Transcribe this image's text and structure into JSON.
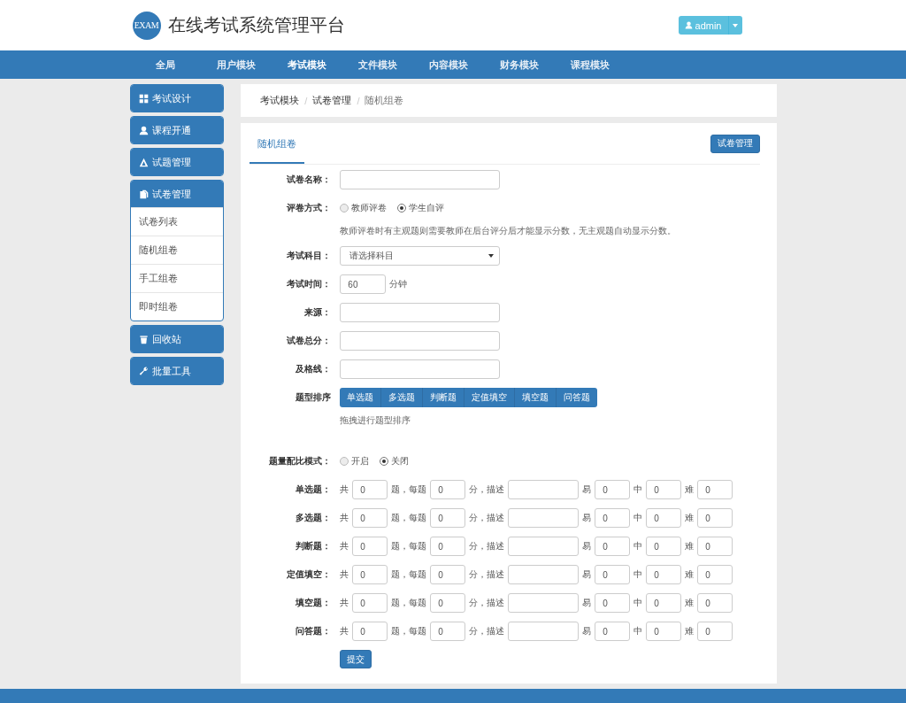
{
  "header": {
    "logo": "EXAM",
    "title": "在线考试系统管理平台",
    "user": "admin"
  },
  "nav": [
    {
      "label": "全局",
      "selected": false
    },
    {
      "label": "用户模块",
      "selected": false
    },
    {
      "label": "考试模块",
      "selected": true
    },
    {
      "label": "文件模块",
      "selected": false
    },
    {
      "label": "内容模块",
      "selected": false
    },
    {
      "label": "财务模块",
      "selected": false
    },
    {
      "label": "课程模块",
      "selected": false
    }
  ],
  "sidebar": [
    {
      "label": "考试设计"
    },
    {
      "label": "课程开通"
    },
    {
      "label": "试题管理"
    },
    {
      "label": "试卷管理",
      "children": [
        {
          "label": "试卷列表",
          "selected": false
        },
        {
          "label": "随机组卷",
          "selected": false
        },
        {
          "label": "手工组卷",
          "selected": false
        },
        {
          "label": "即时组卷",
          "selected": false
        }
      ]
    },
    {
      "label": "回收站"
    },
    {
      "label": "批量工具"
    }
  ],
  "breadcrumb": [
    {
      "label": "考试模块",
      "separator": "/"
    },
    {
      "label": "试卷管理",
      "separator": "/"
    },
    {
      "label": "随机组卷"
    }
  ],
  "tab": "随机组卷",
  "manage_button": "试卷管理",
  "fields": [
    {
      "kind": "text",
      "label": "试卷名称："
    },
    {
      "kind": "radio",
      "label": "评卷方式：",
      "options": [
        {
          "label": "教师评卷",
          "selected": false
        },
        {
          "label": "学生自评",
          "selected": true
        }
      ],
      "hint": "教师评卷时有主观题则需要教师在后台评分后才能显示分数，无主观题自动显示分数。"
    },
    {
      "kind": "select",
      "label": "考试科目：",
      "value": "请选择科目"
    },
    {
      "kind": "unit",
      "label": "考试时间：",
      "value": "60",
      "unit": "分钟"
    },
    {
      "kind": "text",
      "label": "来源："
    },
    {
      "kind": "text",
      "label": "试卷总分："
    },
    {
      "kind": "text",
      "label": "及格线："
    },
    {
      "kind": "sort",
      "label": "题型排序",
      "items": [
        "单选题",
        "多选题",
        "判断题",
        "定值填空",
        "填空题",
        "问答题"
      ],
      "hint": "拖拽进行题型排序"
    },
    {
      "kind": "radio",
      "label": "题量配比模式：",
      "options": [
        {
          "label": "开启",
          "selected": false
        },
        {
          "label": "关闭",
          "selected": true
        }
      ]
    }
  ],
  "question_rows": [
    {
      "label": "单选题：",
      "total_label": "共",
      "count": "0",
      "per_label": "题，每题",
      "score": "0",
      "describe_label": "分，描述",
      "easy_label": "易",
      "easy": "0",
      "medium_label": "中",
      "medium": "0",
      "hard_label": "难",
      "hard": "0"
    },
    {
      "label": "多选题：",
      "total_label": "共",
      "count": "0",
      "per_label": "题，每题",
      "score": "0",
      "describe_label": "分，描述",
      "easy_label": "易",
      "easy": "0",
      "medium_label": "中",
      "medium": "0",
      "hard_label": "难",
      "hard": "0"
    },
    {
      "label": "判断题：",
      "total_label": "共",
      "count": "0",
      "per_label": "题，每题",
      "score": "0",
      "describe_label": "分，描述",
      "easy_label": "易",
      "easy": "0",
      "medium_label": "中",
      "medium": "0",
      "hard_label": "难",
      "hard": "0"
    },
    {
      "label": "定值填空：",
      "total_label": "共",
      "count": "0",
      "per_label": "题，每题",
      "score": "0",
      "describe_label": "分，描述",
      "easy_label": "易",
      "easy": "0",
      "medium_label": "中",
      "medium": "0",
      "hard_label": "难",
      "hard": "0"
    },
    {
      "label": "填空题：",
      "total_label": "共",
      "count": "0",
      "per_label": "题，每题",
      "score": "0",
      "describe_label": "分，描述",
      "easy_label": "易",
      "easy": "0",
      "medium_label": "中",
      "medium": "0",
      "hard_label": "难",
      "hard": "0"
    },
    {
      "label": "问答题：",
      "total_label": "共",
      "count": "0",
      "per_label": "题，每题",
      "score": "0",
      "describe_label": "分，描述",
      "easy_label": "易",
      "easy": "0",
      "medium_label": "中",
      "medium": "0",
      "hard_label": "难",
      "hard": "0"
    }
  ],
  "submit": "提交"
}
